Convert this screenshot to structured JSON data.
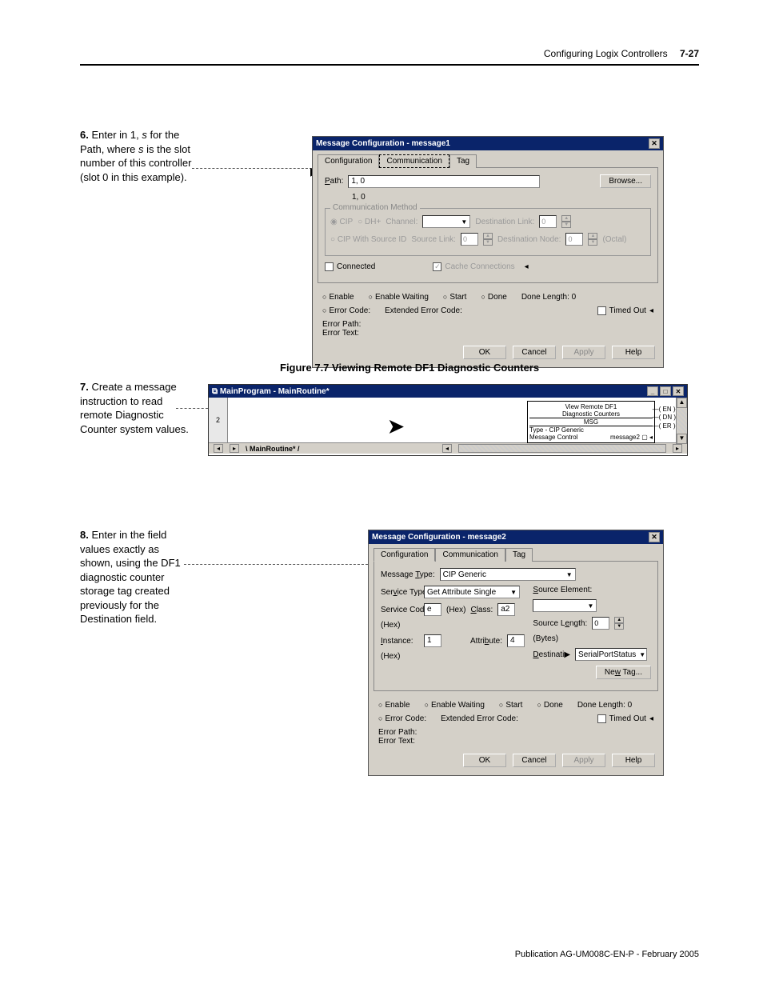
{
  "header": {
    "section": "Configuring Logix Controllers",
    "page": "7-27"
  },
  "footer": "Publication AG-UM008C-EN-P - February 2005",
  "step6": {
    "num": "6.",
    "text_a": "Enter in 1, ",
    "text_b": "s",
    "text_c": " for the Path, where ",
    "text_d": "s",
    "text_e": " is the slot number of this controller (slot 0 in this example)."
  },
  "step7": {
    "num": "7.",
    "text": "Create a message instruction to read remote Diagnostic Counter system values."
  },
  "step8": {
    "num": "8.",
    "text": "Enter in the field values exactly as shown, using the DF1 diagnostic counter storage tag created previously for the Destination field."
  },
  "figcaption": "Figure 7.7 Viewing Remote DF1 Diagnostic Counters",
  "dialog1": {
    "title": "Message Configuration - message1",
    "tabs": {
      "t1": "Configuration",
      "t2": "Communication",
      "t3": "Tag"
    },
    "path_label": "Path:",
    "path_value": "1, 0",
    "path_hint": "1, 0",
    "browse": "Browse...",
    "commmethod_title": "Communication Method",
    "radio_cip": "CIP",
    "radio_dhp": "DH+",
    "channel_label": "Channel:",
    "destlink_label": "Destination Link:",
    "destlink_value": "0",
    "radio_cipsrc": "CIP With Source ID",
    "srclink_label": "Source Link:",
    "srclink_value": "0",
    "destnode_label": "Destination Node:",
    "destnode_value": "0",
    "octal": "(Octal)",
    "connected": "Connected",
    "cache": "Cache Connections",
    "enable": "Enable",
    "enablew": "Enable Waiting",
    "start": "Start",
    "done": "Done",
    "donelen": "Done Length: 0",
    "errcode": "Error Code:",
    "exterr": "Extended Error Code:",
    "timedout": "Timed Out",
    "errpath": "Error Path:",
    "errtext": "Error Text:",
    "ok": "OK",
    "cancel": "Cancel",
    "apply": "Apply",
    "help": "Help"
  },
  "ladder": {
    "title": "MainProgram - MainRoutine*",
    "rung": "2",
    "desc1": "View Remote DF1",
    "desc2": "Diagnostic Counters",
    "msg_hdr": "MSG",
    "type_label": "Type - CIP Generic",
    "msgctrl_label": "Message Control",
    "msgctrl_val": "message2",
    "en": "EN",
    "dn": "DN",
    "er": "ER",
    "tab": "MainRoutine*"
  },
  "dialog2": {
    "title": "Message Configuration - message2",
    "tabs": {
      "t1": "Configuration",
      "t2": "Communication",
      "t3": "Tag"
    },
    "msgtype_label": "Message Type:",
    "msgtype_value": "CIP Generic",
    "svctype_label": "Service Type:",
    "svctype_value": "Get Attribute Single",
    "srcel_label": "Source Element:",
    "srclen_label": "Source Length:",
    "srclen_value": "0",
    "bytes": "(Bytes)",
    "svccode_label": "Service Code:",
    "svccode_value": "e",
    "hex": "(Hex)",
    "class_label": "Class:",
    "class_value": "a2",
    "dest_label": "Destination",
    "dest_value": "SerialPortStatus",
    "instance_label": "Instance:",
    "instance_value": "1",
    "attr_label": "Attribute:",
    "attr_value": "4",
    "newtag": "New Tag...",
    "enable": "Enable",
    "enablew": "Enable Waiting",
    "start": "Start",
    "done": "Done",
    "donelen": "Done Length: 0",
    "errcode": "Error Code:",
    "exterr": "Extended Error Code:",
    "timedout": "Timed Out",
    "errpath": "Error Path:",
    "errtext": "Error Text:",
    "ok": "OK",
    "cancel": "Cancel",
    "apply": "Apply",
    "help": "Help"
  }
}
